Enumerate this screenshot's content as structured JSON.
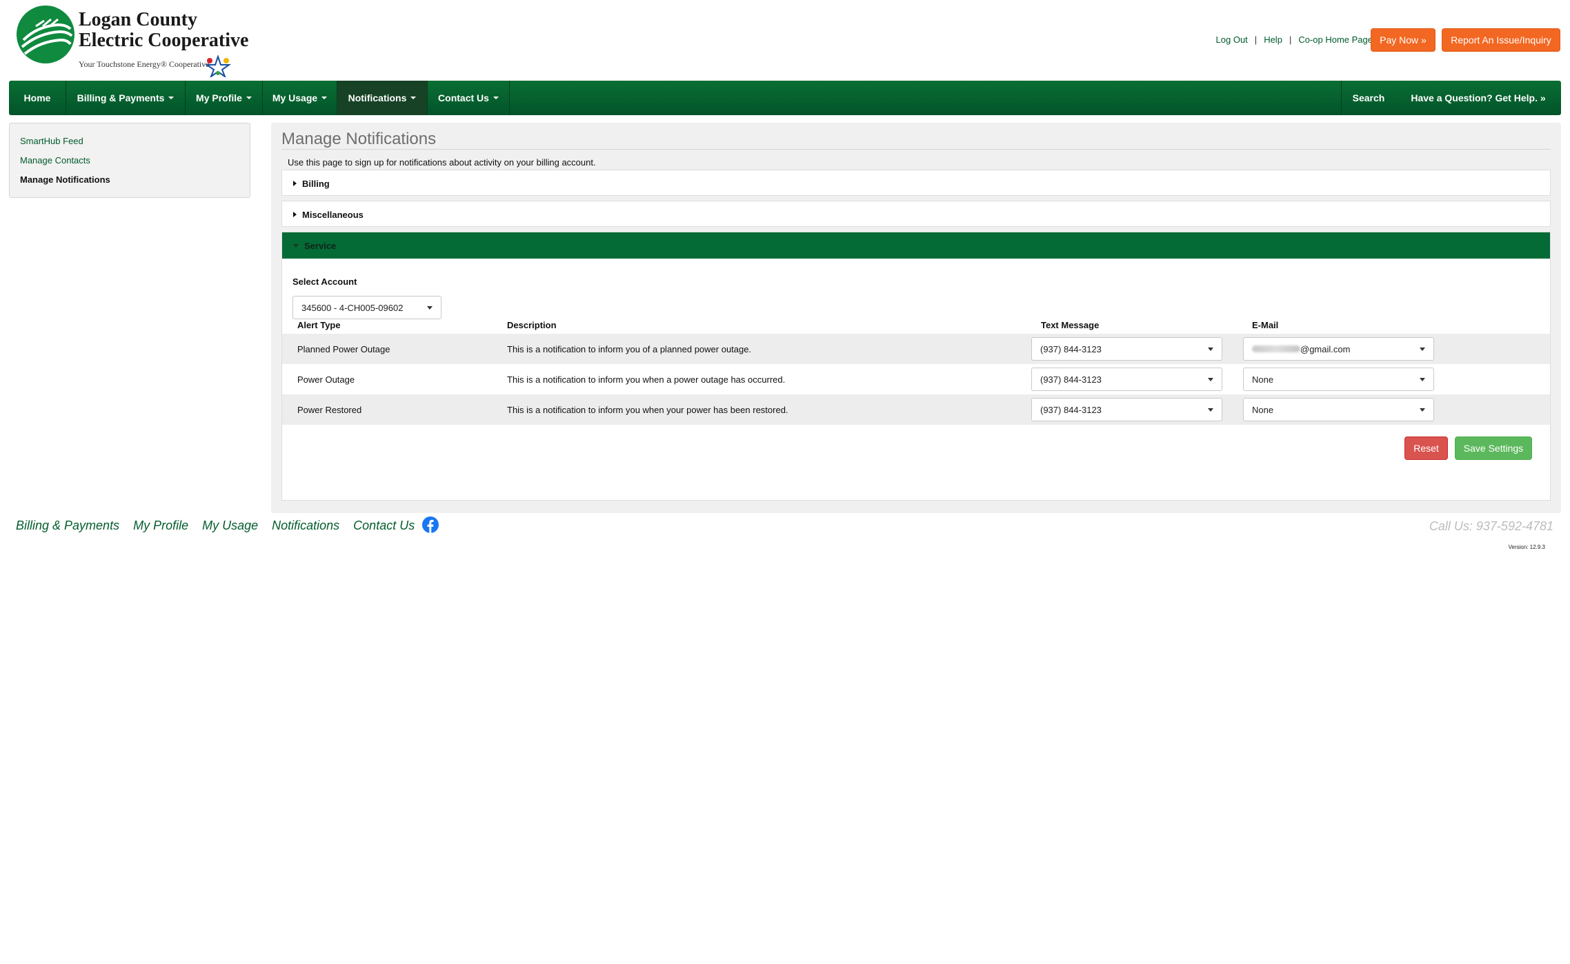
{
  "brand": {
    "line1": "Logan County",
    "line2": "Electric Cooperative",
    "tagline": "Your Touchstone Energy® Cooperative"
  },
  "utility": {
    "logout": "Log Out",
    "help": "Help",
    "home": "Co-op Home Page",
    "pay_now": "Pay Now »",
    "report": "Report An Issue/Inquiry"
  },
  "nav": {
    "items": [
      {
        "label": "Home"
      },
      {
        "label": "Billing & Payments"
      },
      {
        "label": "My Profile"
      },
      {
        "label": "My Usage"
      },
      {
        "label": "Notifications"
      },
      {
        "label": "Contact Us"
      }
    ],
    "search": "Search",
    "question": "Have a Question? Get Help. »"
  },
  "sidebar": {
    "items": [
      {
        "label": "SmartHub Feed"
      },
      {
        "label": "Manage Contacts"
      },
      {
        "label": "Manage Notifications"
      }
    ]
  },
  "main": {
    "title": "Manage Notifications",
    "intro": "Use this page to sign up for notifications about activity on your billing account.",
    "sections": [
      {
        "label": "Billing"
      },
      {
        "label": "Miscellaneous"
      },
      {
        "label": "Service"
      }
    ],
    "select_account_label": "Select Account",
    "account": "345600 - 4-CH005-09602",
    "columns": [
      "Alert Type",
      "Description",
      "Text Message",
      "E-Mail"
    ],
    "rows": [
      {
        "type": "Planned Power Outage",
        "description": "This is a notification to inform you of a planned power outage.",
        "text": "(937) 844-3123",
        "email": "@gmail.com"
      },
      {
        "type": "Power Outage",
        "description": "This is a notification to inform you when a power outage has occurred.",
        "text": "(937) 844-3123",
        "email": "None"
      },
      {
        "type": "Power Restored",
        "description": "This is a notification to inform you when your power has been restored.",
        "text": "(937) 844-3123",
        "email": "None"
      }
    ],
    "reset": "Reset",
    "save": "Save Settings"
  },
  "footer": {
    "links": [
      "Billing & Payments",
      "My Profile",
      "My Usage",
      "Notifications",
      "Contact Us"
    ],
    "call": "Call Us: 937-592-4781",
    "version": "Version: 12.9.3"
  },
  "colors": {
    "brand_green": "#046a36",
    "nav_green": "#02542a",
    "orange": "#f26722",
    "reset_red": "#d9534f",
    "save_green": "#5cb85c"
  }
}
